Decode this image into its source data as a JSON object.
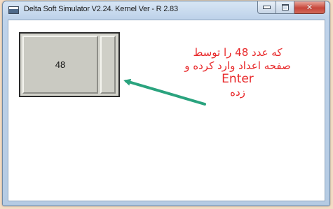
{
  "window": {
    "title": "Delta Soft Simulator V2.24. Kernel Ver - R 2.83"
  },
  "caption_buttons": {
    "minimize_icon": "minimize-icon",
    "maximize_icon": "maximize-icon",
    "close_icon": "close-icon",
    "close_glyph": "✕"
  },
  "display": {
    "value": "48"
  },
  "annotation": {
    "line1": "که عدد 48 را توسط",
    "line2": "صفحه اعداد وارد کرده و",
    "line3": "Enter",
    "line4": "زده",
    "color": "#e8282a",
    "arrow_color": "#2aa37e"
  }
}
